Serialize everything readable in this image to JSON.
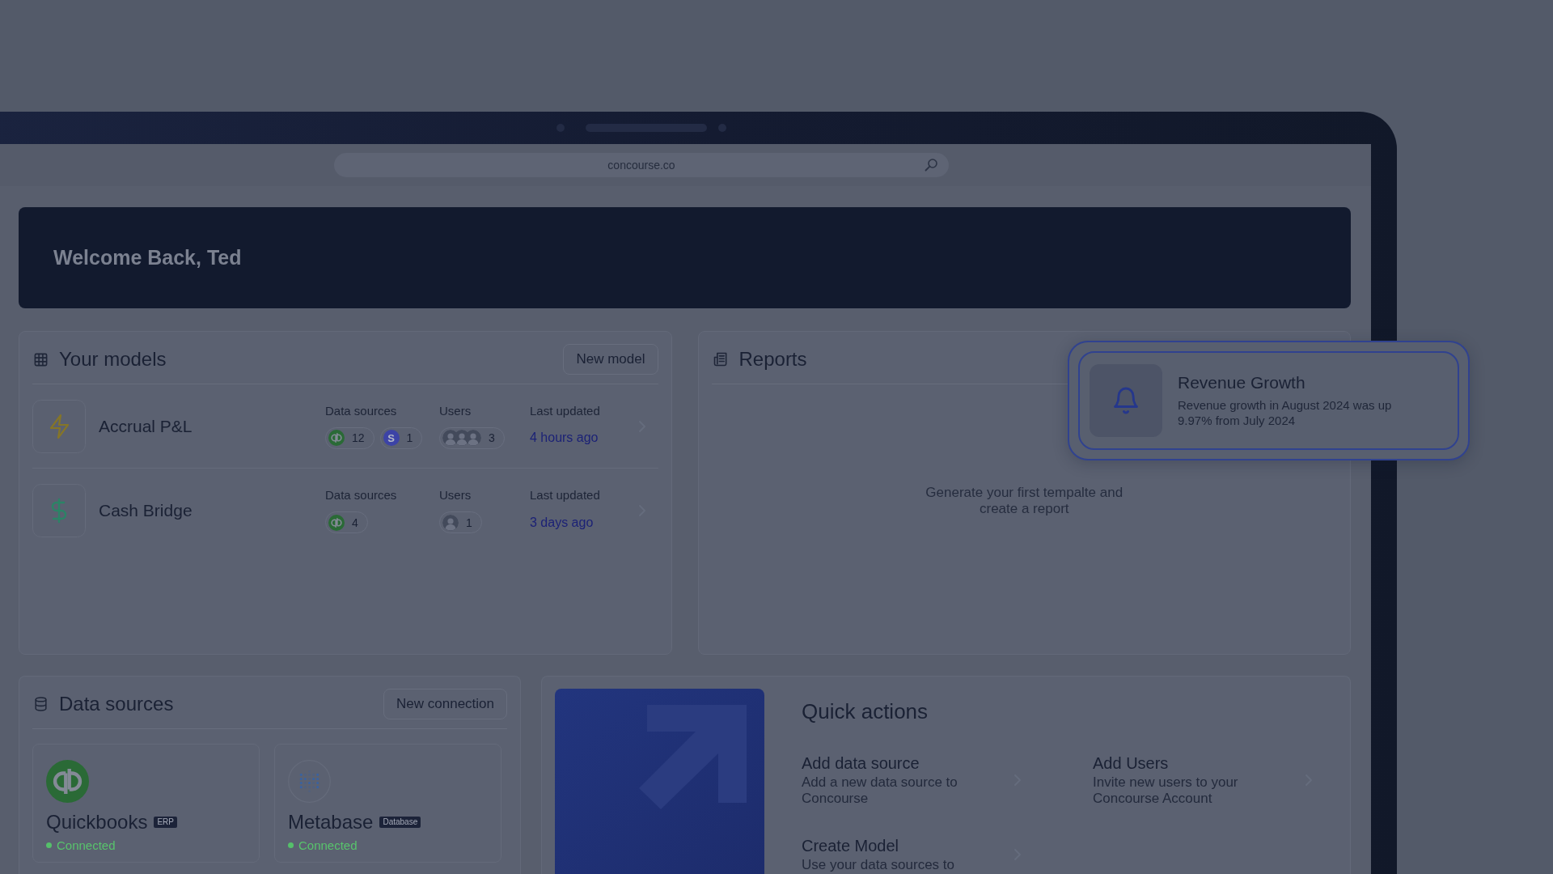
{
  "browser": {
    "url": "concourse.co"
  },
  "welcome": {
    "title": "Welcome Back, Ted"
  },
  "models": {
    "title": "Your models",
    "button": "New model",
    "rows": [
      {
        "kind": "bolt",
        "name": "Accrual P&L",
        "sources_label": "Data sources",
        "sources": [
          {
            "kind": "mark",
            "count": "12"
          },
          {
            "kind": "letter",
            "letter": "S",
            "count": "1"
          }
        ],
        "users_label": "Users",
        "users": {
          "avatars": [
            {
              "kind": "photo"
            },
            {
              "kind": "photo"
            },
            {
              "kind": "photo"
            }
          ],
          "count": "3"
        },
        "updated_label": "Last updated",
        "updated": "4 hours ago"
      },
      {
        "kind": "dollar",
        "name": "Cash Bridge",
        "sources_label": "Data sources",
        "sources": [
          {
            "kind": "mark",
            "count": "4"
          }
        ],
        "users_label": "Users",
        "users": {
          "avatars": [
            {
              "kind": "photo"
            }
          ],
          "count": "1"
        },
        "updated_label": "Last updated",
        "updated": "3 days ago"
      }
    ]
  },
  "reports": {
    "title": "Reports",
    "empty_text": "Generate your first tempalte and create a report"
  },
  "notification": {
    "title": "Revenue Growth",
    "body": "Revenue growth in August 2024 was up 9.97% from July 2024"
  },
  "data_sources": {
    "title": "Data sources",
    "button": "New connection",
    "items": [
      {
        "kind": "mark",
        "name": "Quickbooks",
        "tag": "ERP",
        "connected": true,
        "status": "Connected"
      },
      {
        "kind": "dots",
        "name": "Metabase",
        "tag": "Database",
        "connected": true,
        "status": "Connected"
      }
    ]
  },
  "quick_actions": {
    "title": "Quick actions",
    "actions": [
      {
        "title": "Add data source",
        "description": "Add a new data source to Concourse"
      },
      {
        "title": "Add Users",
        "description": "Invite new users to your Concourse Account"
      },
      {
        "title": "Create Model",
        "description": "Use your data sources to"
      }
    ]
  }
}
